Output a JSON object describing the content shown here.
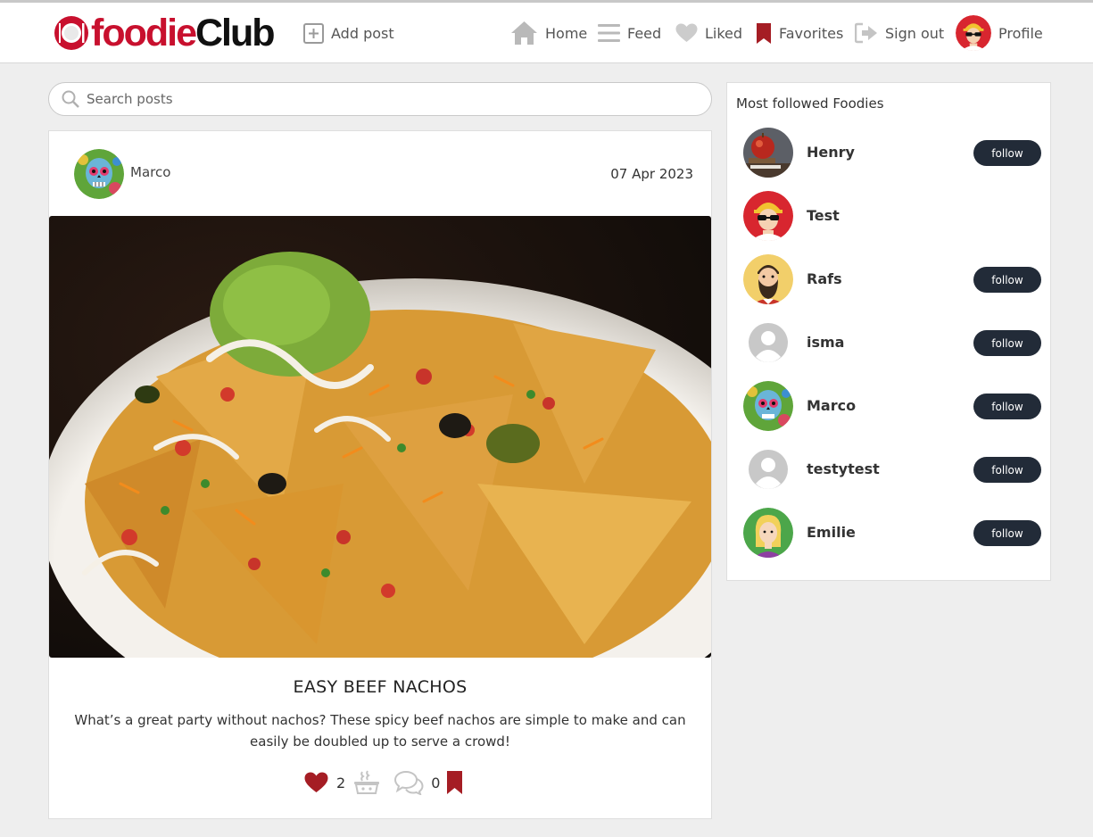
{
  "brand": {
    "part1": "foodie",
    "part2": "Club",
    "accent": "#c8102e"
  },
  "nav": {
    "add_post": "Add post",
    "home": "Home",
    "feed": "Feed",
    "liked": "Liked",
    "favorites": "Favorites",
    "sign_out": "Sign out",
    "profile": "Profile"
  },
  "search": {
    "placeholder": "Search posts",
    "value": ""
  },
  "post": {
    "author": "Marco",
    "date": "07 Apr 2023",
    "title": "EASY BEEF NACHOS",
    "description": "What’s a great party without nachos? These spicy beef nachos are simple to make and can easily be doubled up to serve a crowd!",
    "likes": "2",
    "comments": "0",
    "icons": [
      "heart-icon",
      "cooking-pot-icon",
      "comment-icon",
      "bookmark-icon"
    ]
  },
  "sidebar": {
    "title": "Most followed Foodies",
    "follow_label": "follow",
    "foodies": [
      {
        "name": "Henry",
        "has_follow": true
      },
      {
        "name": "Test",
        "has_follow": false
      },
      {
        "name": "Rafs",
        "has_follow": true
      },
      {
        "name": "isma",
        "has_follow": true
      },
      {
        "name": "Marco",
        "has_follow": true
      },
      {
        "name": "testytest",
        "has_follow": true
      },
      {
        "name": "Emilie",
        "has_follow": true
      }
    ]
  },
  "colors": {
    "button_dark": "#222b38",
    "icon_red": "#a51d24",
    "icon_gray": "#c4c4c4"
  }
}
